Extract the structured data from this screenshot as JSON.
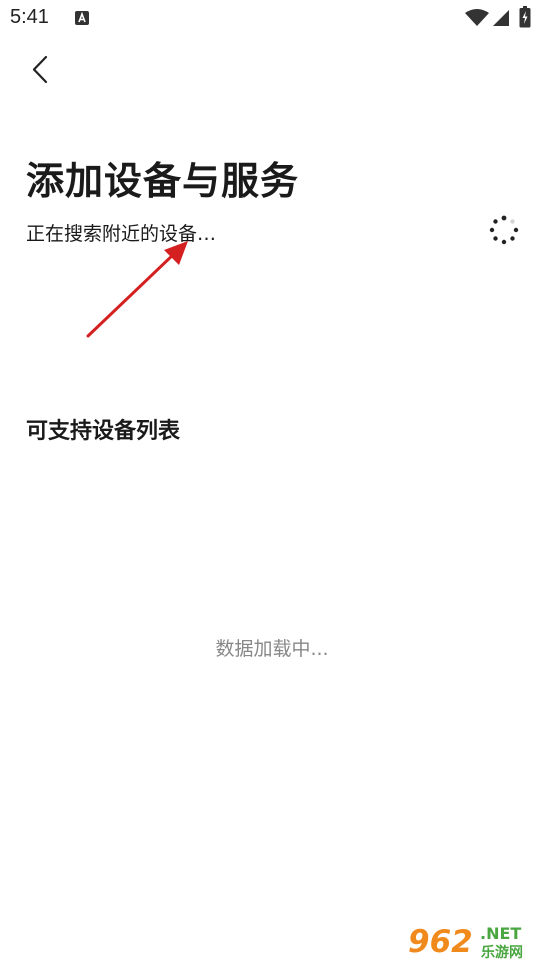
{
  "status_bar": {
    "time": "5:41",
    "icons": [
      "notification-a-icon",
      "wifi-icon",
      "signal-icon",
      "battery-charging-icon"
    ]
  },
  "header": {
    "back_icon": "chevron-left-icon"
  },
  "main": {
    "title": "添加设备与服务",
    "search_status": "正在搜索附近的设备…",
    "spinner_icon": "loading-spinner-icon",
    "section_title": "可支持设备列表",
    "loading_text": "数据加载中..."
  },
  "watermark": {
    "brand_number": "962",
    "brand_suffix": ".NET",
    "brand_cn": "乐游网"
  },
  "colors": {
    "background": "#ffffff",
    "text_primary": "#1a1a1a",
    "text_muted": "#888888",
    "annotation_arrow": "#d42020",
    "watermark_orange": "#f08a1c",
    "watermark_green": "#4aa640"
  }
}
